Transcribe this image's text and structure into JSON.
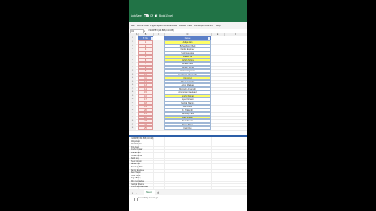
{
  "titlebar": {
    "autosave_label": "AutoSave",
    "autosave_state": "Off",
    "save_icon": "save-icon",
    "filename": "Book1",
    "app_name": "Excel"
  },
  "ribbon": {
    "tabs": [
      "File",
      "Home",
      "Insert",
      "Page Layout",
      "Formulas",
      "Data",
      "Review",
      "View",
      "Developer",
      "Add-ins",
      "Help"
    ]
  },
  "formulabar": {
    "namebox": "D4",
    "fx": "fx",
    "formula": "=SORTBY(B4:B28,C4:C28)"
  },
  "columns": [
    "A",
    "B",
    "C",
    "D",
    "E",
    "F"
  ],
  "table": {
    "header_b": "Sr. No.",
    "header_d": "Names",
    "rows": [
      {
        "n": "1",
        "name": "Aditya Jain",
        "hl": true
      },
      {
        "n": "2",
        "name": "Bishan Singh Bedi",
        "hl": false
      },
      {
        "n": "3",
        "name": "Farokh Engineer",
        "hl": false
      },
      {
        "n": "4",
        "name": "Sunil Gavaskar",
        "hl": false
      },
      {
        "n": "5",
        "name": "Madan Lal",
        "hl": true
      },
      {
        "n": "6",
        "name": "Ashish Nehra",
        "hl": true
      },
      {
        "n": "7",
        "name": "Bharat Patel",
        "hl": false
      },
      {
        "n": "8",
        "name": "Surabh Sinha",
        "hl": false
      },
      {
        "n": "9",
        "name": "Venkataraghavan",
        "hl": false
      },
      {
        "n": "10",
        "name": "Gundappa Viswanath",
        "hl": false
      },
      {
        "n": "11",
        "name": "Kirti Azad",
        "hl": true
      },
      {
        "n": "12",
        "name": "Dilip Vengsarkar",
        "hl": false
      },
      {
        "n": "13",
        "name": "Ashok Mankad",
        "hl": false
      },
      {
        "n": "14",
        "name": "Mohinder Amarnath",
        "hl": false
      },
      {
        "n": "15",
        "name": "Anshuman Gaekwad",
        "hl": false
      },
      {
        "n": "16",
        "name": "Anshul Kumar",
        "hl": true
      },
      {
        "n": "17",
        "name": "Syed Kirmani",
        "hl": false
      },
      {
        "n": "18",
        "name": "Yashpal Sharma",
        "hl": false
      },
      {
        "n": "19",
        "name": "Dilip Doshi",
        "hl": false
      },
      {
        "n": "20",
        "name": "K. Srikkanth",
        "hl": false
      },
      {
        "n": "21",
        "name": "Sandeep Patil",
        "hl": false
      },
      {
        "n": "22",
        "name": "Ravi Shastri",
        "hl": true
      },
      {
        "n": "23",
        "name": "Sunil Kumar",
        "hl": false
      },
      {
        "n": "24",
        "name": "Roger Binny",
        "hl": false
      },
      {
        "n": "25",
        "name": "Kapil Dev",
        "hl": false
      }
    ]
  },
  "bottom_pane": {
    "formula": "=SORTBY(B4:B28,C4:C28)",
    "lines": [
      "Aditya Jain",
      "Ashish Nehra",
      "Kirti Azad",
      "Anshul Kumar",
      "Bharat Patel",
      "Surabh Sinha",
      "Kapil Dev",
      "Syed Kirmani",
      "Madan Lal",
      "Sandeep Patil",
      "Farokh Engineer",
      "Ravi Shastri",
      "Sunil Kumar",
      "Roger Binny",
      "Dilip Vengsarkar",
      "Yashpal Sharma",
      "Anshuman Gaekwad"
    ]
  },
  "sheetbar": {
    "sheet_name": "Sheet1",
    "add_icon": "plus-icon"
  },
  "statusbar": {
    "text": "Accessibility: Good to go"
  }
}
